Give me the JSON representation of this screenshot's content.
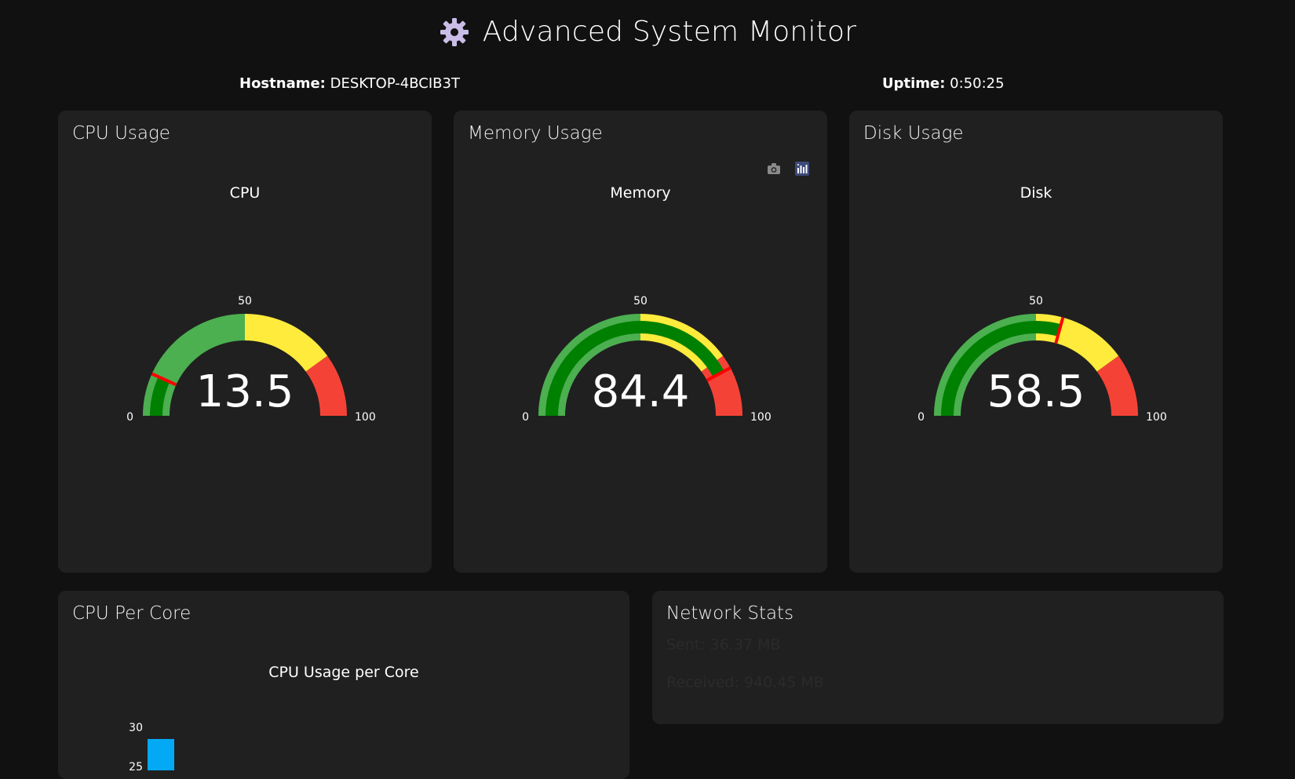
{
  "header": {
    "title": "Advanced System Monitor",
    "icon": "gear-icon",
    "icon_color": "#c9bde8"
  },
  "info": {
    "hostname_label": "Hostname:",
    "hostname_value": "DESKTOP-4BCIB3T",
    "uptime_label": "Uptime:",
    "uptime_value": "0:50:25"
  },
  "cards": {
    "cpu": {
      "heading": "CPU Usage",
      "gauge_title": "CPU",
      "value": 13.5,
      "value_text": "13.5"
    },
    "memory": {
      "heading": "Memory Usage",
      "gauge_title": "Memory",
      "value": 84.4,
      "value_text": "84.4"
    },
    "disk": {
      "heading": "Disk Usage",
      "gauge_title": "Disk",
      "value": 58.5,
      "value_text": "58.5"
    }
  },
  "gauge_scale": {
    "min": 0,
    "mid": 50,
    "max": 100,
    "min_label": "0",
    "mid_label": "50",
    "max_label": "100"
  },
  "colors": {
    "green_band": "#4caf50",
    "yellow_band": "#ffeb3b",
    "red_band": "#f44336",
    "value_bar": "#008000",
    "threshold": "#ff0000",
    "bar": "#03a9f4"
  },
  "cpu_per_core": {
    "heading": "CPU Per Core",
    "chart_title": "CPU Usage per Core",
    "y_ticks": [
      "30",
      "25"
    ]
  },
  "network": {
    "heading": "Network Stats",
    "sent": "Sent: 36.37 MB",
    "received": "Received: 940.45 MB"
  },
  "chart_data": {
    "type": "bar",
    "title": "CPU Usage per Core",
    "categories": [
      ""
    ],
    "values": [
      28.5
    ],
    "y_ticks_visible": [
      25,
      30
    ]
  }
}
